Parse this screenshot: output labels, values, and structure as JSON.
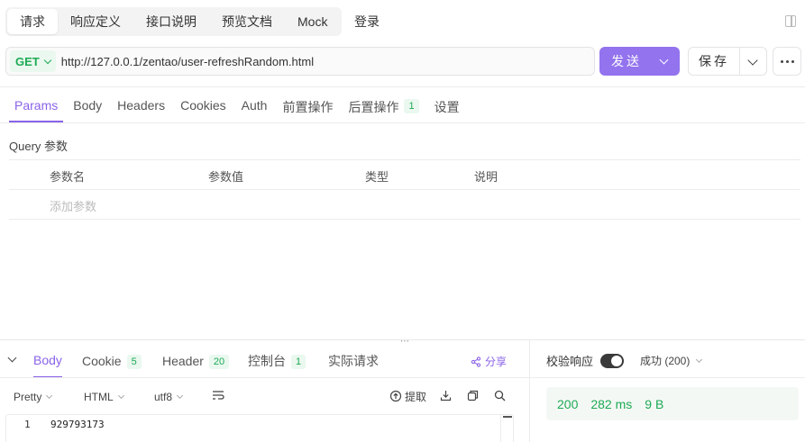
{
  "top_tabs": [
    "请求",
    "响应定义",
    "接口说明",
    "预览文档",
    "Mock"
  ],
  "login_tab": "登录",
  "request": {
    "method": "GET",
    "url": "http://127.0.0.1/zentao/user-refreshRandom.html",
    "send_label": "发送",
    "save_label": "保存"
  },
  "req_tabs": {
    "params": "Params",
    "body": "Body",
    "headers": "Headers",
    "cookies": "Cookies",
    "auth": "Auth",
    "pre": "前置操作",
    "post": "后置操作",
    "post_count": "1",
    "settings": "设置"
  },
  "query": {
    "title": "Query 参数",
    "columns": [
      "参数名",
      "参数值",
      "类型",
      "说明"
    ],
    "add_placeholder": "添加参数"
  },
  "response": {
    "tabs": {
      "body": "Body",
      "cookie": "Cookie",
      "cookie_count": "5",
      "header": "Header",
      "header_count": "20",
      "console": "控制台",
      "console_count": "1",
      "actual": "实际请求"
    },
    "share": "分享",
    "format": "Pretty",
    "type": "HTML",
    "encoding": "utf8",
    "extract": "提取",
    "line_number": "1",
    "body_text": "929793173",
    "verify_label": "校验响应",
    "status_select": "成功 (200)",
    "status_code": "200",
    "time": "282 ms",
    "size": "9 B"
  },
  "colors": {
    "accent": "#8a63e8",
    "send_button": "#9373ee",
    "success": "#1eaa55"
  }
}
